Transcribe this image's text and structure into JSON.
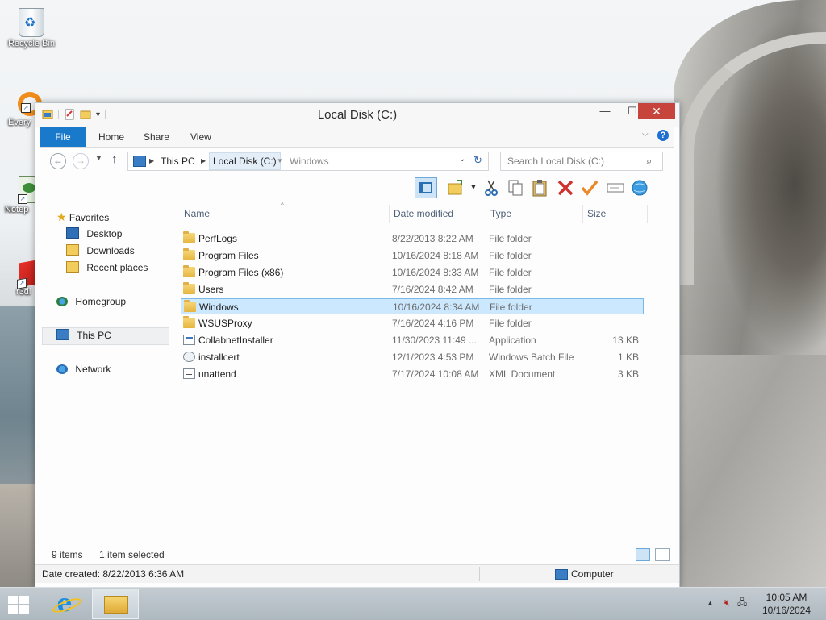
{
  "desktop": {
    "icons": [
      {
        "label": "Recycle Bin"
      },
      {
        "label": "Every"
      },
      {
        "label": "Notep"
      },
      {
        "label": "r3di"
      }
    ]
  },
  "window": {
    "title": "Local Disk (C:)",
    "close_glyph": "✕",
    "max_glyph": "☐",
    "min_glyph": "—"
  },
  "ribbon": {
    "tabs": [
      "File",
      "Home",
      "Share",
      "View"
    ]
  },
  "address": {
    "crumbs": [
      "This PC",
      "Local Disk (C:)"
    ],
    "ghost": "Windows",
    "search_placeholder": "Search Local Disk (C:)"
  },
  "sidebar": {
    "favorites_label": "Favorites",
    "favorites": [
      "Desktop",
      "Downloads",
      "Recent places"
    ],
    "homegroup": "Homegroup",
    "this_pc": "This PC",
    "network": "Network"
  },
  "columns": {
    "name": "Name",
    "date": "Date modified",
    "type": "Type",
    "size": "Size"
  },
  "files": [
    {
      "name": "PerfLogs",
      "date": "8/22/2013 8:22 AM",
      "type": "File folder",
      "size": "",
      "kind": "folder"
    },
    {
      "name": "Program Files",
      "date": "10/16/2024 8:18 AM",
      "type": "File folder",
      "size": "",
      "kind": "folder"
    },
    {
      "name": "Program Files (x86)",
      "date": "10/16/2024 8:33 AM",
      "type": "File folder",
      "size": "",
      "kind": "folder"
    },
    {
      "name": "Users",
      "date": "7/16/2024 8:42 AM",
      "type": "File folder",
      "size": "",
      "kind": "folder"
    },
    {
      "name": "Windows",
      "date": "10/16/2024 8:34 AM",
      "type": "File folder",
      "size": "",
      "kind": "folder",
      "selected": true
    },
    {
      "name": "WSUSProxy",
      "date": "7/16/2024 4:16 PM",
      "type": "File folder",
      "size": "",
      "kind": "folder"
    },
    {
      "name": "CollabnetInstaller",
      "date": "11/30/2023 11:49 ...",
      "type": "Application",
      "size": "13 KB",
      "kind": "app"
    },
    {
      "name": "installcert",
      "date": "12/1/2023 4:53 PM",
      "type": "Windows Batch File",
      "size": "1 KB",
      "kind": "bat"
    },
    {
      "name": "unattend",
      "date": "7/17/2024 10:08 AM",
      "type": "XML Document",
      "size": "3 KB",
      "kind": "xml"
    }
  ],
  "status": {
    "count": "9 items",
    "selection": "1 item selected"
  },
  "details": {
    "date_created": "Date created: 8/22/2013 6:36 AM",
    "location": "Computer"
  },
  "taskbar": {
    "time": "10:05 AM",
    "date": "10/16/2024"
  },
  "colors": {
    "accent": "#1979ca",
    "selection": "#cce8ff",
    "close": "#c7443c"
  }
}
